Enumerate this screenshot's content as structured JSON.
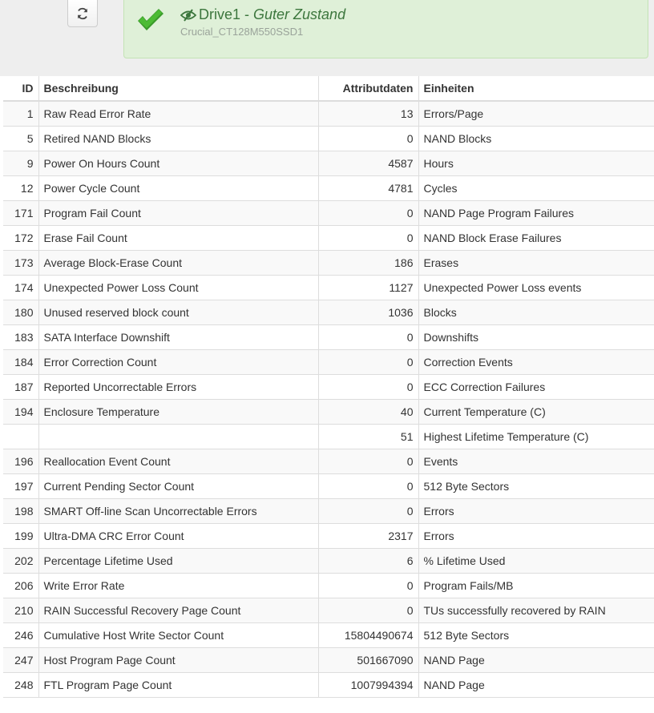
{
  "header": {
    "drive_name": "Drive1",
    "separator": " - ",
    "drive_state": "Guter Zustand",
    "drive_model": "Crucial_CT128M550SSD1",
    "status_color": "#3c763d"
  },
  "table": {
    "columns": {
      "id": "ID",
      "description": "Beschreibung",
      "value": "Attributdaten",
      "unit": "Einheiten"
    },
    "rows": [
      {
        "id": "1",
        "description": "Raw Read Error Rate",
        "value": "13",
        "unit": "Errors/Page"
      },
      {
        "id": "5",
        "description": "Retired NAND Blocks",
        "value": "0",
        "unit": "NAND Blocks"
      },
      {
        "id": "9",
        "description": "Power On Hours Count",
        "value": "4587",
        "unit": "Hours"
      },
      {
        "id": "12",
        "description": "Power Cycle Count",
        "value": "4781",
        "unit": "Cycles"
      },
      {
        "id": "171",
        "description": "Program Fail Count",
        "value": "0",
        "unit": "NAND Page Program Failures"
      },
      {
        "id": "172",
        "description": "Erase Fail Count",
        "value": "0",
        "unit": "NAND Block Erase Failures"
      },
      {
        "id": "173",
        "description": "Average Block-Erase Count",
        "value": "186",
        "unit": "Erases"
      },
      {
        "id": "174",
        "description": "Unexpected Power Loss Count",
        "value": "1127",
        "unit": "Unexpected Power Loss events"
      },
      {
        "id": "180",
        "description": "Unused reserved block count",
        "value": "1036",
        "unit": "Blocks"
      },
      {
        "id": "183",
        "description": "SATA Interface Downshift",
        "value": "0",
        "unit": "Downshifts"
      },
      {
        "id": "184",
        "description": "Error Correction Count",
        "value": "0",
        "unit": "Correction Events"
      },
      {
        "id": "187",
        "description": "Reported Uncorrectable Errors",
        "value": "0",
        "unit": "ECC Correction Failures"
      },
      {
        "id": "194",
        "description": "Enclosure Temperature",
        "value": "40",
        "unit": "Current Temperature (C)"
      },
      {
        "id": "",
        "description": "",
        "value": "51",
        "unit": "Highest Lifetime Temperature (C)"
      },
      {
        "id": "196",
        "description": "Reallocation Event Count",
        "value": "0",
        "unit": "Events"
      },
      {
        "id": "197",
        "description": "Current Pending Sector Count",
        "value": "0",
        "unit": "512 Byte Sectors"
      },
      {
        "id": "198",
        "description": "SMART Off-line Scan Uncorrectable Errors",
        "value": "0",
        "unit": "Errors"
      },
      {
        "id": "199",
        "description": "Ultra-DMA CRC Error Count",
        "value": "2317",
        "unit": "Errors"
      },
      {
        "id": "202",
        "description": "Percentage Lifetime Used",
        "value": "6",
        "unit": "% Lifetime Used"
      },
      {
        "id": "206",
        "description": "Write Error Rate",
        "value": "0",
        "unit": "Program Fails/MB"
      },
      {
        "id": "210",
        "description": "RAIN Successful Recovery Page Count",
        "value": "0",
        "unit": "TUs successfully recovered by RAIN"
      },
      {
        "id": "246",
        "description": "Cumulative Host Write Sector Count",
        "value": "15804490674",
        "unit": "512 Byte Sectors"
      },
      {
        "id": "247",
        "description": "Host Program Page Count",
        "value": "501667090",
        "unit": "NAND Page"
      },
      {
        "id": "248",
        "description": "FTL Program Page Count",
        "value": "1007994394",
        "unit": "NAND Page"
      }
    ]
  },
  "icons": {
    "refresh": "refresh-icon",
    "status": "check-icon",
    "visibility": "eye-slash-icon"
  }
}
